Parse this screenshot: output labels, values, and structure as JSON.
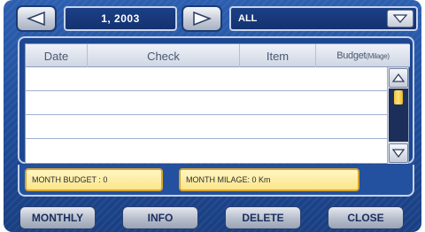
{
  "toolbar": {
    "prev_icon": "left-triangle-icon",
    "next_icon": "right-triangle-icon",
    "month_value": "1, 2003",
    "filter_value": "ALL",
    "filter_dropdown_icon": "chevron-down-icon"
  },
  "table": {
    "columns": [
      "Date",
      "Check",
      "Item",
      "Budget"
    ],
    "budget_suffix": "(Milage)",
    "rows": [
      [],
      [],
      [],
      []
    ],
    "scroll": {
      "up_icon": "scroll-up-icon",
      "down_icon": "scroll-down-icon",
      "position": 0
    }
  },
  "summary": {
    "month_budget": "MONTH BUDGET : 0",
    "month_milage": "MONTH MILAGE: 0 Km"
  },
  "buttons": {
    "monthly": "MONTHLY",
    "info": "INFO",
    "delete": "DELETE",
    "close": "CLOSE"
  },
  "colors": {
    "background": "#1f4c99",
    "summary_fill": "#fbe58a",
    "scroll_thumb": "#f0c43a"
  }
}
